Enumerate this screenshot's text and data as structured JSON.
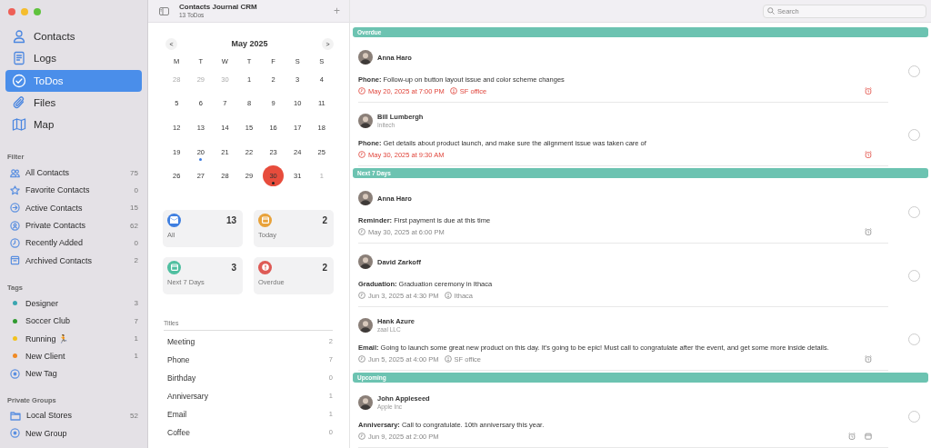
{
  "window": {
    "title": "Contacts Journal CRM",
    "subtitle": "13 ToDos",
    "add": "+"
  },
  "search": {
    "placeholder": "Search"
  },
  "nav": [
    {
      "label": "Contacts",
      "selected": false
    },
    {
      "label": "Logs",
      "selected": false
    },
    {
      "label": "ToDos",
      "selected": true
    },
    {
      "label": "Files",
      "selected": false
    },
    {
      "label": "Map",
      "selected": false
    }
  ],
  "filter": {
    "heading": "Filter",
    "items": [
      {
        "label": "All Contacts",
        "count": "75"
      },
      {
        "label": "Favorite Contacts",
        "count": "0"
      },
      {
        "label": "Active Contacts",
        "count": "15"
      },
      {
        "label": "Private Contacts",
        "count": "62"
      },
      {
        "label": "Recently Added",
        "count": "0"
      },
      {
        "label": "Archived Contacts",
        "count": "2"
      }
    ]
  },
  "tags": {
    "heading": "Tags",
    "items": [
      {
        "kind": "tag",
        "label": "Designer",
        "count": "3",
        "color": "#3aa6b0"
      },
      {
        "kind": "tag",
        "label": "Soccer Club",
        "count": "7",
        "color": "#2f9a2f"
      },
      {
        "kind": "tag",
        "label": "Running 🏃",
        "count": "1",
        "color": "#f2c21f"
      },
      {
        "kind": "tag",
        "label": "New Client",
        "count": "1",
        "color": "#f08a24"
      },
      {
        "kind": "add",
        "label": "New Tag"
      }
    ]
  },
  "groups": {
    "heading": "Private Groups",
    "items": [
      {
        "kind": "group",
        "label": "Local Stores",
        "count": "52"
      },
      {
        "kind": "add",
        "label": "New Group"
      }
    ]
  },
  "calendar": {
    "month": "May 2025",
    "prev": "<",
    "next": ">",
    "weekdays": [
      "M",
      "T",
      "W",
      "T",
      "F",
      "S",
      "S"
    ],
    "weeks": [
      [
        {
          "day": "28",
          "outside": true,
          "selected": false,
          "event": false
        },
        {
          "day": "29",
          "outside": true,
          "selected": false,
          "event": false
        },
        {
          "day": "30",
          "outside": true,
          "selected": false,
          "event": false
        },
        {
          "day": "1",
          "outside": false,
          "selected": false,
          "event": false
        },
        {
          "day": "2",
          "outside": false,
          "selected": false,
          "event": false
        },
        {
          "day": "3",
          "outside": false,
          "selected": false,
          "event": false
        },
        {
          "day": "4",
          "outside": false,
          "selected": false,
          "event": false
        }
      ],
      [
        {
          "day": "5",
          "outside": false,
          "selected": false,
          "event": false
        },
        {
          "day": "6",
          "outside": false,
          "selected": false,
          "event": false
        },
        {
          "day": "7",
          "outside": false,
          "selected": false,
          "event": false
        },
        {
          "day": "8",
          "outside": false,
          "selected": false,
          "event": false
        },
        {
          "day": "9",
          "outside": false,
          "selected": false,
          "event": false
        },
        {
          "day": "10",
          "outside": false,
          "selected": false,
          "event": false
        },
        {
          "day": "11",
          "outside": false,
          "selected": false,
          "event": false
        }
      ],
      [
        {
          "day": "12",
          "outside": false,
          "selected": false,
          "event": false
        },
        {
          "day": "13",
          "outside": false,
          "selected": false,
          "event": false
        },
        {
          "day": "14",
          "outside": false,
          "selected": false,
          "event": false
        },
        {
          "day": "15",
          "outside": false,
          "selected": false,
          "event": false
        },
        {
          "day": "16",
          "outside": false,
          "selected": false,
          "event": false
        },
        {
          "day": "17",
          "outside": false,
          "selected": false,
          "event": false
        },
        {
          "day": "18",
          "outside": false,
          "selected": false,
          "event": false
        }
      ],
      [
        {
          "day": "19",
          "outside": false,
          "selected": false,
          "event": false
        },
        {
          "day": "20",
          "outside": false,
          "selected": false,
          "event": true
        },
        {
          "day": "21",
          "outside": false,
          "selected": false,
          "event": false
        },
        {
          "day": "22",
          "outside": false,
          "selected": false,
          "event": false
        },
        {
          "day": "23",
          "outside": false,
          "selected": false,
          "event": false
        },
        {
          "day": "24",
          "outside": false,
          "selected": false,
          "event": false
        },
        {
          "day": "25",
          "outside": false,
          "selected": false,
          "event": false
        }
      ],
      [
        {
          "day": "26",
          "outside": false,
          "selected": false,
          "event": false
        },
        {
          "day": "27",
          "outside": false,
          "selected": false,
          "event": false
        },
        {
          "day": "28",
          "outside": false,
          "selected": false,
          "event": false
        },
        {
          "day": "29",
          "outside": false,
          "selected": false,
          "event": false
        },
        {
          "day": "30",
          "outside": false,
          "selected": true,
          "event": true
        },
        {
          "day": "31",
          "outside": false,
          "selected": false,
          "event": false
        },
        {
          "day": "1",
          "outside": true,
          "selected": false,
          "event": false
        }
      ]
    ]
  },
  "summary": [
    {
      "label": "All",
      "count": "13",
      "color": "#3f7fe0"
    },
    {
      "label": "Today",
      "count": "2",
      "color": "#e8a23a"
    },
    {
      "label": "Next 7 Days",
      "count": "3",
      "color": "#4fbfa0"
    },
    {
      "label": "Overdue",
      "count": "2",
      "color": "#de5a55"
    }
  ],
  "titles": {
    "heading": "Titles",
    "items": [
      {
        "label": "Meeting",
        "count": "2"
      },
      {
        "label": "Phone",
        "count": "7"
      },
      {
        "label": "Birthday",
        "count": "0"
      },
      {
        "label": "Anniversary",
        "count": "1"
      },
      {
        "label": "Email",
        "count": "1"
      },
      {
        "label": "Coffee",
        "count": "0"
      }
    ]
  },
  "sections": [
    {
      "title": "Overdue",
      "todos": [
        {
          "name": "Anna Haro",
          "type": "Phone:",
          "text": "Follow-up on button layout issue and color scheme changes",
          "time": "May 20, 2025 at 7:00 PM",
          "location": "SF office",
          "overdue": true,
          "alarm": true,
          "calendar_event": false,
          "done": false
        },
        {
          "name": "Bill Lumbergh",
          "company": "Initech",
          "type": "Phone:",
          "text": "Get details about product launch, and make sure the alignment issue was taken care of",
          "time": "May 30, 2025 at 9:30 AM",
          "overdue": true,
          "alarm": true,
          "calendar_event": false,
          "done": false
        }
      ]
    },
    {
      "title": "Next 7 Days",
      "todos": [
        {
          "name": "Anna Haro",
          "type": "Reminder:",
          "text": "First payment is due at this time",
          "time": "May 30, 2025 at 6:00 PM",
          "overdue": false,
          "alarm": true,
          "calendar_event": false,
          "done": false
        },
        {
          "name": "David Zarkoff",
          "type": "Graduation:",
          "text": "Graduation ceremony in Ithaca",
          "time": "Jun 3, 2025 at 4:30 PM",
          "location": "Ithaca",
          "overdue": false,
          "alarm": false,
          "calendar_event": false,
          "done": false
        },
        {
          "name": "Hank Azure",
          "company": "zaal LLC",
          "type": "Email:",
          "text": "Going to launch some great new product on this day. It's going to be epic! Must call to congratulate after the event, and get some more inside details.",
          "time": "Jun 5, 2025 at 4:00 PM",
          "location": "SF office",
          "overdue": false,
          "alarm": true,
          "calendar_event": false,
          "done": false
        }
      ]
    },
    {
      "title": "Upcoming",
      "todos": [
        {
          "name": "John Appleseed",
          "company": "Apple Inc",
          "type": "Anniversary:",
          "text": "Call to congratulate. 10th anniversary this year.",
          "time": "Jun 9, 2025 at 2:00 PM",
          "overdue": false,
          "alarm": true,
          "calendar_event": true,
          "done": false
        }
      ]
    }
  ]
}
